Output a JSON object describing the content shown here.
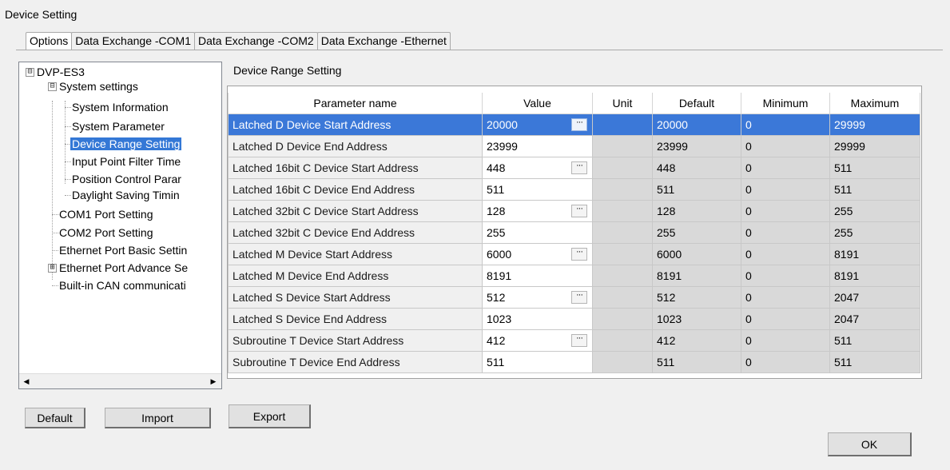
{
  "window": {
    "title": "Device Setting"
  },
  "tabs": [
    {
      "label": "Options"
    },
    {
      "label": "Data Exchange -COM1"
    },
    {
      "label": "Data Exchange -COM2"
    },
    {
      "label": "Data Exchange -Ethernet"
    }
  ],
  "tree": {
    "root": "DVP-ES3",
    "system_settings": "System settings",
    "items": [
      "System Information",
      "System Parameter",
      "Device Range Setting",
      "Input Point Filter Time",
      "Position Control Parar",
      "Daylight Saving Timin"
    ],
    "ports": [
      "COM1 Port Setting",
      "COM2 Port Setting",
      "Ethernet Port Basic Settin",
      "Ethernet Port Advance Se",
      "Built-in CAN communicati"
    ],
    "expand_collapse_symbol": "⊟",
    "expand_symbol": "⊞",
    "selected": "Device Range Setting"
  },
  "section": {
    "title": "Device Range Setting"
  },
  "grid": {
    "columns": [
      "Parameter name",
      "Value",
      "Unit",
      "Default",
      "Minimum",
      "Maximum"
    ],
    "rows": [
      {
        "name": "Latched D Device Start Address",
        "value": "20000",
        "unit": "",
        "default": "20000",
        "min": "0",
        "max": "29999",
        "has_button": true,
        "selected": true
      },
      {
        "name": "Latched D Device End Address",
        "value": "23999",
        "unit": "",
        "default": "23999",
        "min": "0",
        "max": "29999",
        "has_button": false
      },
      {
        "name": "Latched 16bit C Device Start Address",
        "value": "448",
        "unit": "",
        "default": "448",
        "min": "0",
        "max": "511",
        "has_button": true
      },
      {
        "name": "Latched 16bit C Device End Address",
        "value": "511",
        "unit": "",
        "default": "511",
        "min": "0",
        "max": "511",
        "has_button": false
      },
      {
        "name": "Latched 32bit C Device Start Address",
        "value": "128",
        "unit": "",
        "default": "128",
        "min": "0",
        "max": "255",
        "has_button": true
      },
      {
        "name": "Latched 32bit C Device End Address",
        "value": "255",
        "unit": "",
        "default": "255",
        "min": "0",
        "max": "255",
        "has_button": false
      },
      {
        "name": "Latched M Device Start Address",
        "value": "6000",
        "unit": "",
        "default": "6000",
        "min": "0",
        "max": "8191",
        "has_button": true
      },
      {
        "name": "Latched M Device End Address",
        "value": "8191",
        "unit": "",
        "default": "8191",
        "min": "0",
        "max": "8191",
        "has_button": false
      },
      {
        "name": "Latched S Device Start Address",
        "value": "512",
        "unit": "",
        "default": "512",
        "min": "0",
        "max": "2047",
        "has_button": true
      },
      {
        "name": "Latched S Device End Address",
        "value": "1023",
        "unit": "",
        "default": "1023",
        "min": "0",
        "max": "2047",
        "has_button": false
      },
      {
        "name": "Subroutine T Device Start Address",
        "value": "412",
        "unit": "",
        "default": "412",
        "min": "0",
        "max": "511",
        "has_button": true
      },
      {
        "name": "Subroutine T Device End Address",
        "value": "511",
        "unit": "",
        "default": "511",
        "min": "0",
        "max": "511",
        "has_button": false
      }
    ],
    "ellipsis": "···"
  },
  "buttons": {
    "default": "Default",
    "import": "Import",
    "export": "Export",
    "ok": "OK"
  },
  "scroll": {
    "left_arrow": "◀",
    "right_arrow": "▶"
  }
}
